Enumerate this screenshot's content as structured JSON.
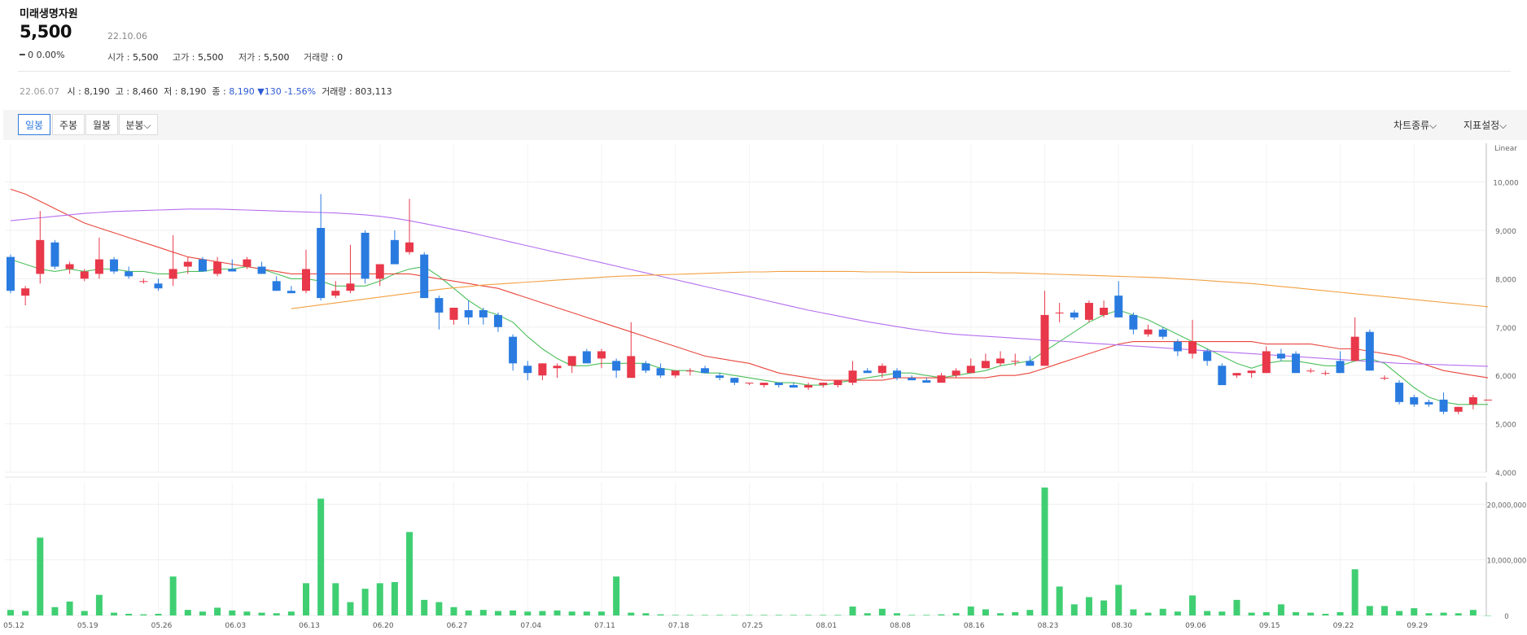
{
  "stock": {
    "name": "미래생명자원",
    "price": "5,500",
    "change": "━ 0  0.00%",
    "date": "22.10.06",
    "open_label": "시가 : ",
    "open": "5,500",
    "high_label": "고가 : ",
    "high": "5,500",
    "low_label": "저가 : ",
    "low": "5,500",
    "volume_label": "거래량 : ",
    "volume": "0"
  },
  "prev_bar": {
    "date": "22.06.07",
    "open": "시 : 8,190",
    "high": "고 : 8,460",
    "low": "저 : 8,190",
    "close_label": "종 : ",
    "close": "8,190 ▼130 -1.56%",
    "volume": "거래량 : 803,113"
  },
  "toolbar": {
    "tabs": [
      "일봉",
      "주봉",
      "월봉",
      "분봉⌵"
    ],
    "chart_type": "차트종류⌵",
    "indicator": "지표설정⌵"
  },
  "colors": {
    "up": "#e8384a",
    "down": "#2a7be0",
    "volume": "#3fcf72",
    "ma5": "#4cbf5c",
    "ma20": "#e8473c",
    "ma60": "#b56ef0",
    "ma120": "#f2a043"
  },
  "chart_data": [
    {
      "type": "candlestick",
      "scale": "Linear",
      "ylim": [
        4000,
        10800
      ],
      "y_ticks": [
        "10,000",
        "9,000",
        "8,000",
        "7,000",
        "6,000",
        "5,000",
        "4,000"
      ],
      "x_ticks": [
        "05.12",
        "05.19",
        "05.26",
        "06.03",
        "06.13",
        "06.20",
        "06.27",
        "07.04",
        "07.11",
        "07.18",
        "07.25",
        "08.01",
        "08.08",
        "08.16",
        "08.23",
        "08.30",
        "09.06",
        "09.15",
        "09.22",
        "09.29"
      ],
      "x_tick_index": [
        0,
        5,
        10,
        15,
        20,
        25,
        30,
        35,
        40,
        45,
        50,
        55,
        60,
        65,
        70,
        75,
        80,
        85,
        90,
        95
      ],
      "ohlc": [
        [
          8450,
          8500,
          7700,
          7750
        ],
        [
          7650,
          7850,
          7450,
          7800
        ],
        [
          8100,
          9400,
          7900,
          8800
        ],
        [
          8750,
          8800,
          8200,
          8250
        ],
        [
          8200,
          8350,
          8100,
          8300
        ],
        [
          8000,
          8200,
          7950,
          8150
        ],
        [
          8100,
          8850,
          8000,
          8400
        ],
        [
          8400,
          8450,
          8100,
          8150
        ],
        [
          8150,
          8250,
          8000,
          8050
        ],
        [
          7950,
          8000,
          7900,
          7950
        ],
        [
          7900,
          8000,
          7750,
          7800
        ],
        [
          8000,
          8900,
          7850,
          8200
        ],
        [
          8250,
          8450,
          8100,
          8350
        ],
        [
          8400,
          8450,
          8150,
          8150
        ],
        [
          8100,
          8450,
          8050,
          8350
        ],
        [
          8200,
          8400,
          8150,
          8150
        ],
        [
          8250,
          8450,
          8200,
          8400
        ],
        [
          8250,
          8350,
          8100,
          8100
        ],
        [
          7950,
          8050,
          7750,
          7750
        ],
        [
          7750,
          7850,
          7700,
          7700
        ],
        [
          7750,
          8600,
          7700,
          8200
        ],
        [
          9050,
          9750,
          7550,
          7600
        ],
        [
          7650,
          7950,
          7600,
          7750
        ],
        [
          7750,
          8700,
          7700,
          7900
        ],
        [
          8950,
          9000,
          7900,
          8000
        ],
        [
          8000,
          8300,
          7850,
          8300
        ],
        [
          8800,
          9000,
          8300,
          8300
        ],
        [
          8550,
          9650,
          8500,
          8750
        ],
        [
          8500,
          8550,
          7600,
          7600
        ],
        [
          7600,
          7650,
          6950,
          7300
        ],
        [
          7150,
          7400,
          7050,
          7400
        ],
        [
          7350,
          7550,
          7050,
          7200
        ],
        [
          7350,
          7400,
          7050,
          7200
        ],
        [
          7250,
          7300,
          6900,
          7000
        ],
        [
          6800,
          6850,
          6100,
          6250
        ],
        [
          6200,
          6300,
          5900,
          6050
        ],
        [
          6000,
          6250,
          5900,
          6250
        ],
        [
          6150,
          6250,
          5950,
          6200
        ],
        [
          6200,
          6400,
          6050,
          6400
        ],
        [
          6500,
          6550,
          6250,
          6250
        ],
        [
          6350,
          6550,
          6150,
          6500
        ],
        [
          6300,
          6350,
          5950,
          6100
        ],
        [
          5950,
          7100,
          5950,
          6400
        ],
        [
          6250,
          6300,
          6050,
          6100
        ],
        [
          6150,
          6250,
          5950,
          6000
        ],
        [
          6000,
          6100,
          5950,
          6100
        ],
        [
          6100,
          6150,
          6000,
          6100
        ],
        [
          6150,
          6200,
          6050,
          6050
        ],
        [
          6000,
          6050,
          5900,
          5950
        ],
        [
          5950,
          5950,
          5800,
          5850
        ],
        [
          5850,
          5850,
          5800,
          5850
        ],
        [
          5800,
          5850,
          5750,
          5850
        ],
        [
          5850,
          5850,
          5750,
          5800
        ],
        [
          5800,
          5850,
          5750,
          5750
        ],
        [
          5750,
          5850,
          5700,
          5800
        ],
        [
          5800,
          5850,
          5750,
          5850
        ],
        [
          5800,
          5900,
          5750,
          5900
        ],
        [
          5850,
          6300,
          5800,
          6100
        ],
        [
          6100,
          6150,
          6050,
          6050
        ],
        [
          6050,
          6250,
          5950,
          6200
        ],
        [
          6100,
          6150,
          5900,
          5950
        ],
        [
          5950,
          6000,
          5900,
          5900
        ],
        [
          5900,
          5950,
          5850,
          5850
        ],
        [
          5850,
          6050,
          5850,
          6000
        ],
        [
          6000,
          6150,
          5950,
          6100
        ],
        [
          6050,
          6350,
          6050,
          6200
        ],
        [
          6150,
          6450,
          6150,
          6300
        ],
        [
          6250,
          6500,
          6200,
          6350
        ],
        [
          6300,
          6450,
          6200,
          6300
        ],
        [
          6300,
          6400,
          6200,
          6200
        ],
        [
          6200,
          7750,
          6200,
          7250
        ],
        [
          7300,
          7500,
          7100,
          7300
        ],
        [
          7300,
          7350,
          7150,
          7200
        ],
        [
          7150,
          7550,
          7100,
          7500
        ],
        [
          7250,
          7550,
          7200,
          7400
        ],
        [
          7650,
          7950,
          7200,
          7200
        ],
        [
          7250,
          7300,
          6850,
          6950
        ],
        [
          6850,
          7050,
          6800,
          6950
        ],
        [
          6950,
          7000,
          6750,
          6800
        ],
        [
          6700,
          6750,
          6400,
          6500
        ],
        [
          6450,
          7150,
          6350,
          6700
        ],
        [
          6500,
          6550,
          6200,
          6300
        ],
        [
          6200,
          6250,
          5800,
          5800
        ],
        [
          6000,
          6050,
          5950,
          6050
        ],
        [
          6050,
          6100,
          5950,
          6100
        ],
        [
          6050,
          6600,
          6050,
          6500
        ],
        [
          6450,
          6550,
          6300,
          6350
        ],
        [
          6450,
          6500,
          6050,
          6050
        ],
        [
          6100,
          6150,
          6050,
          6100
        ],
        [
          6050,
          6100,
          6000,
          6050
        ],
        [
          6300,
          6500,
          6050,
          6050
        ],
        [
          6300,
          7200,
          6300,
          6800
        ],
        [
          6900,
          6950,
          6100,
          6100
        ],
        [
          5950,
          6000,
          5900,
          5950
        ],
        [
          5850,
          5900,
          5400,
          5450
        ],
        [
          5550,
          5600,
          5350,
          5400
        ],
        [
          5450,
          5500,
          5350,
          5400
        ],
        [
          5500,
          5650,
          5200,
          5250
        ],
        [
          5250,
          5350,
          5200,
          5350
        ],
        [
          5400,
          5600,
          5300,
          5550
        ],
        [
          5500,
          5500,
          5500,
          5500
        ]
      ],
      "moving_averages": [
        {
          "period": 5,
          "color": "#4cbf5c",
          "values": [
            8400,
            8300,
            8200,
            8150,
            8200,
            8150,
            8200,
            8200,
            8150,
            8150,
            8100,
            8100,
            8150,
            8150,
            8200,
            8200,
            8250,
            8200,
            8100,
            8000,
            8000,
            7950,
            7850,
            7850,
            7850,
            7950,
            8100,
            8200,
            8250,
            8050,
            7800,
            7550,
            7350,
            7250,
            7100,
            6800,
            6550,
            6350,
            6200,
            6200,
            6250,
            6250,
            6250,
            6250,
            6150,
            6100,
            6100,
            6050,
            6050,
            6000,
            5950,
            5900,
            5850,
            5850,
            5800,
            5800,
            5850,
            5900,
            5950,
            6000,
            6050,
            6050,
            6000,
            5950,
            6000,
            6050,
            6100,
            6200,
            6250,
            6300,
            6500,
            6700,
            6900,
            7100,
            7250,
            7350,
            7250,
            7150,
            7000,
            6850,
            6700,
            6550,
            6400,
            6250,
            6150,
            6250,
            6300,
            6300,
            6250,
            6200,
            6200,
            6300,
            6350,
            6250,
            6000,
            5750,
            5550,
            5450,
            5400,
            5400,
            5400
          ]
        },
        {
          "period": 20,
          "color": "#e8473c",
          "values": [
            9850,
            9750,
            9600,
            9450,
            9300,
            9150,
            9050,
            8950,
            8850,
            8750,
            8650,
            8550,
            8450,
            8400,
            8350,
            8300,
            8250,
            8200,
            8150,
            8100,
            8100,
            8100,
            8100,
            8100,
            8100,
            8100,
            8100,
            8100,
            8050,
            8000,
            7950,
            7900,
            7850,
            7800,
            7700,
            7600,
            7500,
            7400,
            7300,
            7200,
            7100,
            7000,
            6900,
            6800,
            6700,
            6600,
            6500,
            6400,
            6350,
            6300,
            6250,
            6150,
            6050,
            6000,
            5950,
            5900,
            5900,
            5900,
            5900,
            5900,
            5950,
            5950,
            5950,
            5950,
            5950,
            5950,
            5950,
            6000,
            6000,
            6050,
            6150,
            6250,
            6350,
            6450,
            6550,
            6650,
            6700,
            6700,
            6700,
            6700,
            6700,
            6700,
            6700,
            6700,
            6700,
            6650,
            6650,
            6650,
            6650,
            6600,
            6550,
            6550,
            6500,
            6450,
            6400,
            6300,
            6200,
            6100,
            6050,
            6000,
            5950
          ]
        },
        {
          "period": 60,
          "color": "#b56ef0",
          "values": [
            9200,
            9230,
            9260,
            9290,
            9320,
            9350,
            9370,
            9390,
            9400,
            9410,
            9420,
            9430,
            9440,
            9440,
            9440,
            9430,
            9420,
            9410,
            9400,
            9390,
            9380,
            9370,
            9360,
            9340,
            9320,
            9290,
            9250,
            9200,
            9140,
            9080,
            9020,
            8960,
            8890,
            8820,
            8750,
            8680,
            8610,
            8540,
            8470,
            8400,
            8330,
            8260,
            8190,
            8120,
            8050,
            7980,
            7910,
            7840,
            7770,
            7700,
            7630,
            7560,
            7490,
            7420,
            7350,
            7290,
            7230,
            7170,
            7110,
            7060,
            7010,
            6960,
            6920,
            6880,
            6850,
            6830,
            6810,
            6790,
            6770,
            6750,
            6730,
            6710,
            6690,
            6670,
            6650,
            6630,
            6610,
            6590,
            6570,
            6550,
            6530,
            6510,
            6490,
            6470,
            6450,
            6430,
            6410,
            6390,
            6370,
            6350,
            6330,
            6310,
            6290,
            6270,
            6250,
            6240,
            6230,
            6220,
            6210,
            6200,
            6190
          ]
        },
        {
          "period": 120,
          "color": "#f2a043",
          "start_index": 19,
          "values": [
            7380,
            7420,
            7460,
            7500,
            7540,
            7580,
            7620,
            7660,
            7700,
            7740,
            7780,
            7810,
            7840,
            7870,
            7890,
            7910,
            7930,
            7950,
            7970,
            7990,
            8010,
            8030,
            8050,
            8060,
            8070,
            8080,
            8090,
            8100,
            8110,
            8120,
            8130,
            8140,
            8140,
            8150,
            8150,
            8150,
            8150,
            8150,
            8150,
            8140,
            8140,
            8140,
            8130,
            8130,
            8130,
            8130,
            8130,
            8130,
            8120,
            8120,
            8110,
            8100,
            8090,
            8080,
            8070,
            8060,
            8050,
            8040,
            8030,
            8020,
            8000,
            7980,
            7960,
            7940,
            7920,
            7900,
            7870,
            7840,
            7810,
            7780,
            7750,
            7720,
            7690,
            7660,
            7630,
            7600,
            7570,
            7540,
            7510,
            7480,
            7450,
            7420
          ]
        }
      ]
    },
    {
      "type": "bar",
      "series": "volume",
      "ylim": [
        0,
        24000000
      ],
      "y_ticks": [
        "20,000,000",
        "10,000,000",
        "0"
      ],
      "values": [
        1000000,
        800000,
        14000000,
        1500000,
        2500000,
        800000,
        3700000,
        500000,
        300000,
        200000,
        300000,
        7000000,
        1000000,
        700000,
        1400000,
        900000,
        700000,
        500000,
        400000,
        700000,
        5800000,
        21000000,
        5800000,
        2400000,
        4800000,
        5800000,
        6000000,
        15000000,
        2800000,
        2400000,
        1500000,
        900000,
        1000000,
        800000,
        900000,
        700000,
        800000,
        900000,
        700000,
        700000,
        700000,
        7000000,
        500000,
        400000,
        200000,
        100000,
        100000,
        100000,
        100000,
        100000,
        100000,
        100000,
        100000,
        100000,
        100000,
        100000,
        100000,
        1600000,
        400000,
        1200000,
        400000,
        100000,
        100000,
        200000,
        400000,
        1600000,
        1100000,
        400000,
        600000,
        1000000,
        23000000,
        5200000,
        2000000,
        3300000,
        2700000,
        5500000,
        1100000,
        500000,
        1200000,
        700000,
        3600000,
        800000,
        700000,
        2800000,
        500000,
        600000,
        2000000,
        600000,
        500000,
        300000,
        600000,
        8300000,
        1700000,
        1700000,
        800000,
        1300000,
        400000,
        500000,
        400000,
        1000000,
        0
      ]
    }
  ]
}
